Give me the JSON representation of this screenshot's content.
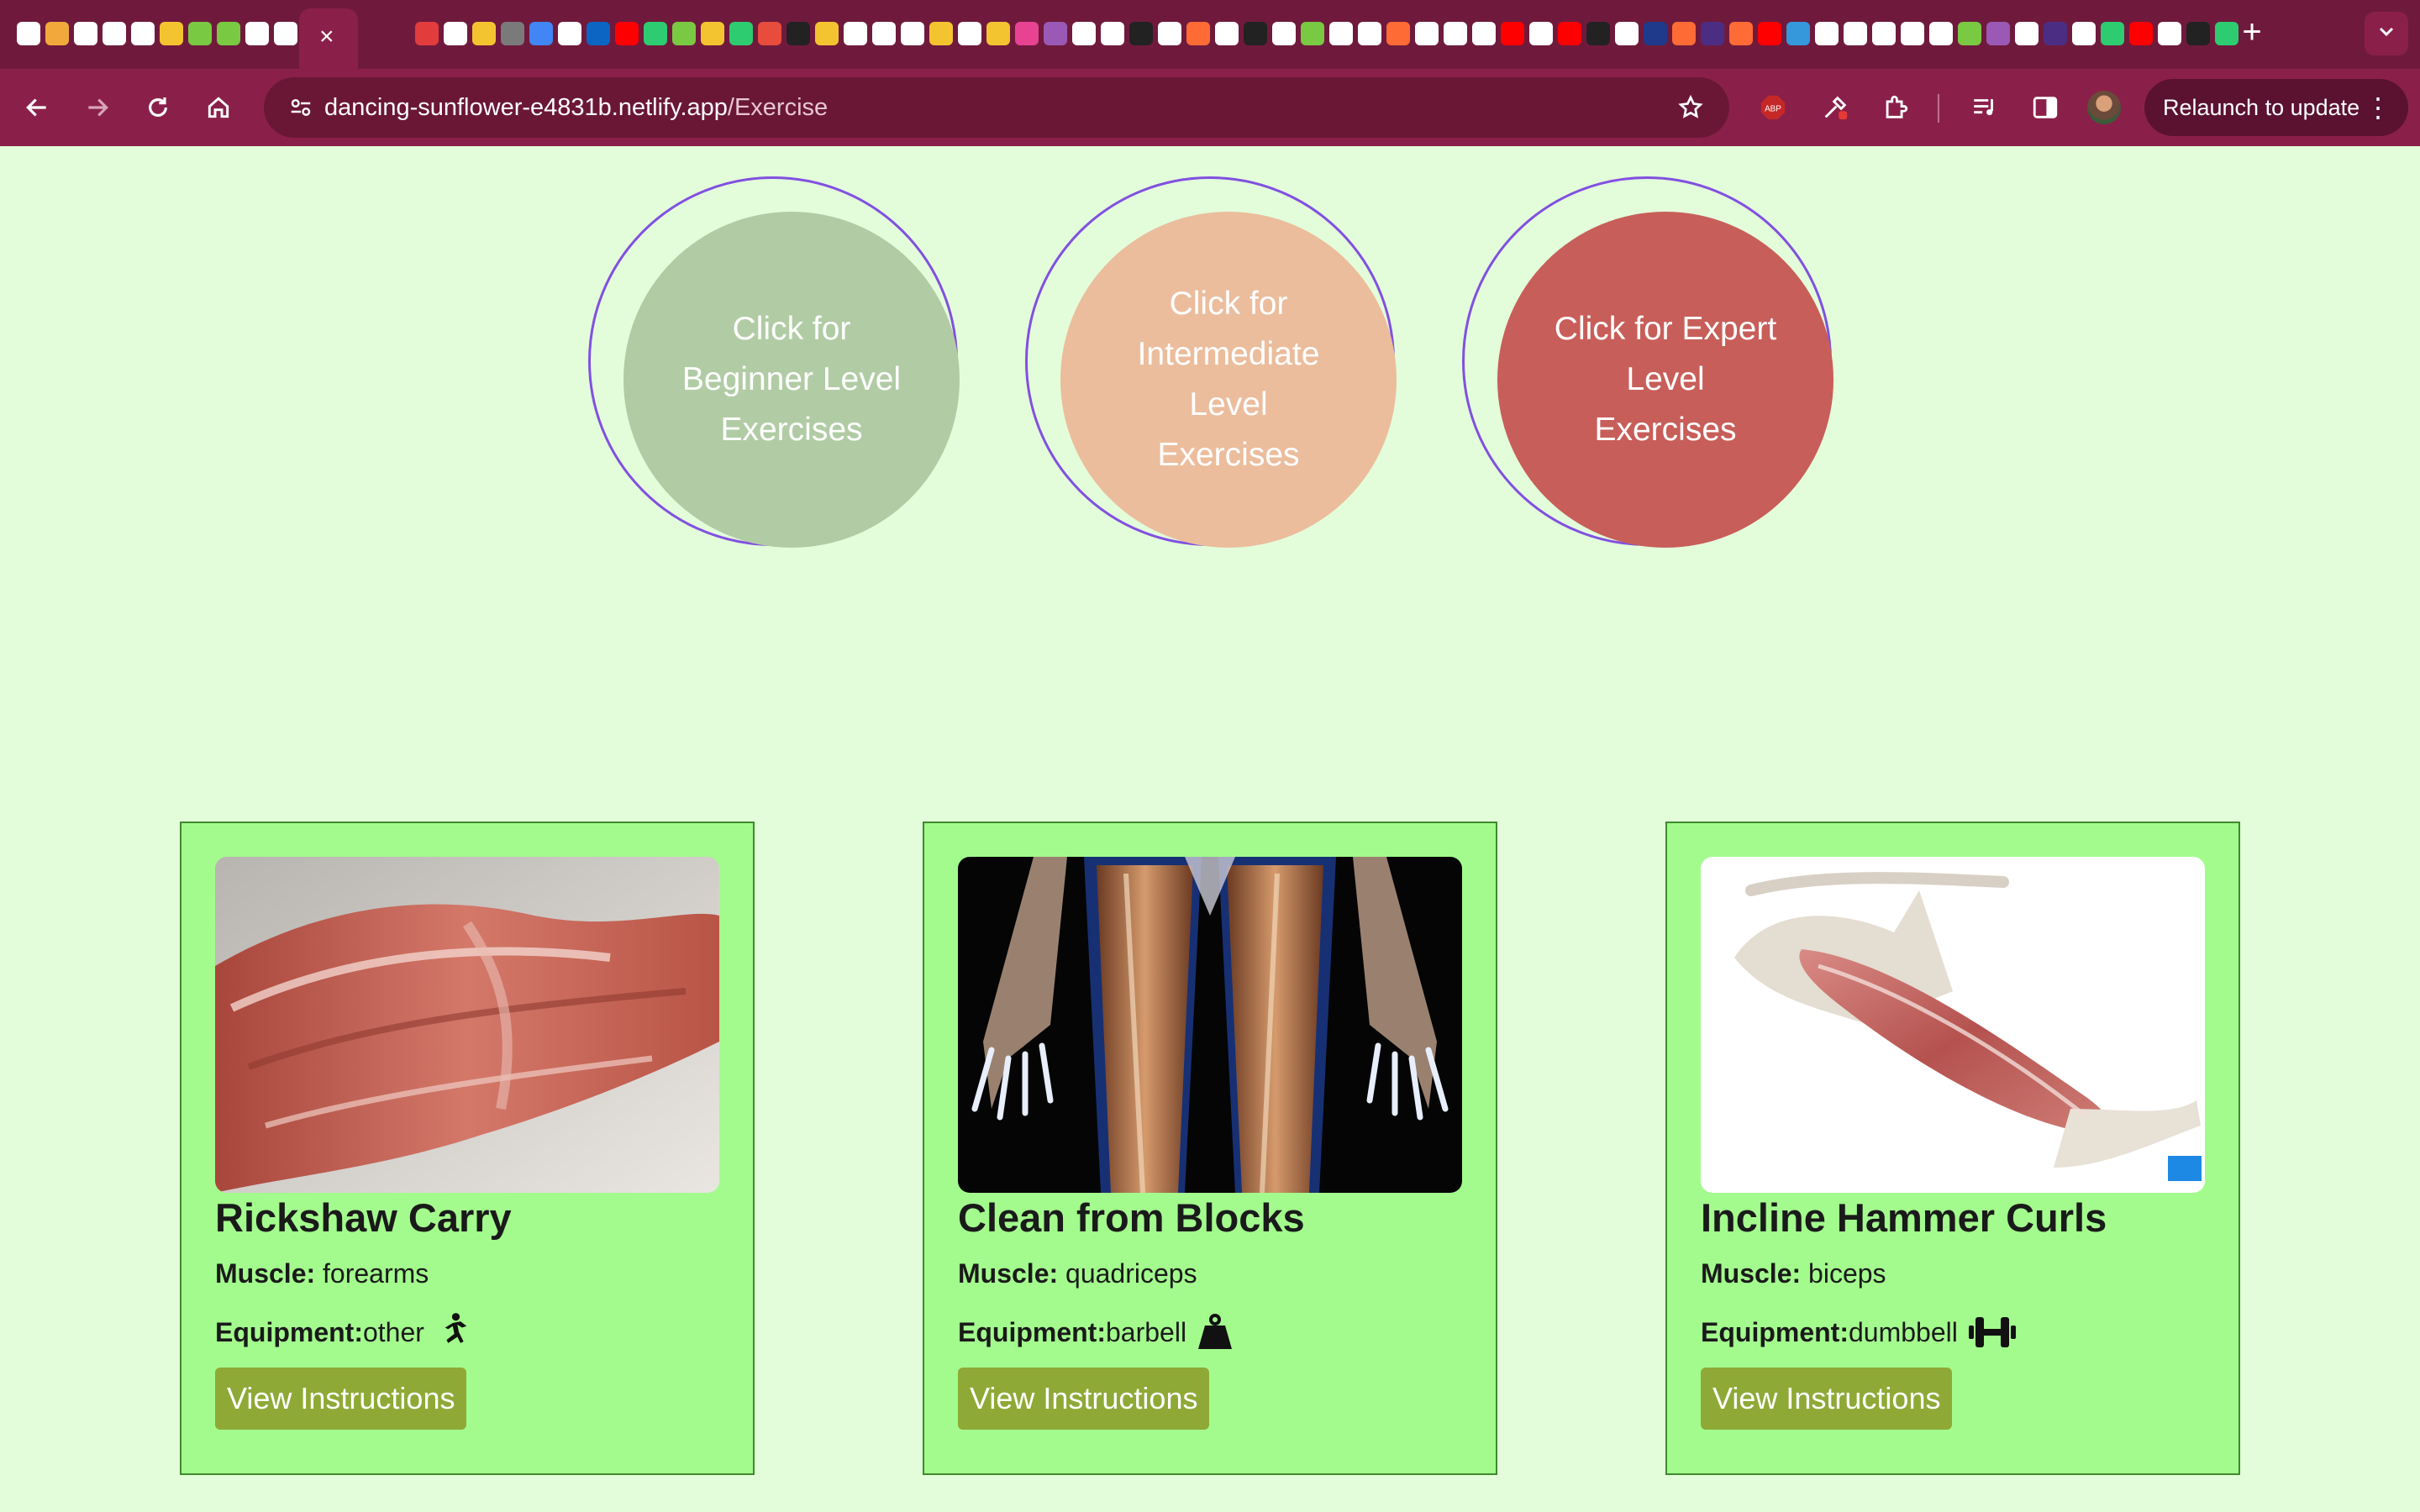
{
  "browser": {
    "tab_close_glyph": "×",
    "new_tab_glyph": "+",
    "url_host": "dancing-sunflower-e4831b.netlify.app",
    "url_path": "/Exercise",
    "relaunch_label": "Relaunch to update",
    "favicon_colors": [
      "#ffffff",
      "#f2a93b",
      "#ffffff",
      "#ffffff",
      "#ffffff",
      "#f4c430",
      "#7ac943",
      "#7ac943",
      "#ffffff",
      "#ffffff",
      "#ffffff",
      "#e23c3c",
      "#ffffff",
      "#f4c430",
      "#7a7a7a",
      "#4285f4",
      "#ffffff",
      "#0a66c2",
      "#ff0000",
      "#2ecc71",
      "#7ac943",
      "#f4c430",
      "#2ecc71",
      "#e74c3c",
      "#222222",
      "#f4c430",
      "#ffffff",
      "#ffffff",
      "#ffffff",
      "#f4c430",
      "#ffffff",
      "#f4c430",
      "#e84393",
      "#9b59b6",
      "#ffffff",
      "#ffffff",
      "#222222",
      "#ffffff",
      "#ff6b35",
      "#ffffff",
      "#222222",
      "#ffffff",
      "#7ac943",
      "#ffffff",
      "#ffffff",
      "#ff6b35",
      "#ffffff",
      "#ffffff",
      "#ffffff",
      "#ff0000",
      "#ffffff",
      "#ff0000",
      "#222222",
      "#ffffff",
      "#1f3a8a",
      "#ff6b35",
      "#4b2e83",
      "#ff6b35",
      "#ff0000",
      "#3498db",
      "#ffffff",
      "#ffffff",
      "#ffffff",
      "#ffffff",
      "#ffffff",
      "#7ac943",
      "#9b59b6",
      "#ffffff",
      "#4b2e83",
      "#ffffff",
      "#2ecc71",
      "#ff0000",
      "#ffffff",
      "#222222",
      "#2ecc71",
      "#2ecc71",
      "#ffffff",
      "#222222",
      "#ffffff",
      "#ffffff",
      "#222222",
      "#ff0000",
      "#ffffff",
      "#ff0000",
      "#ffffff",
      "#ff6b35",
      "#ff0000",
      "#3498db",
      "#3498db",
      "#ffffff"
    ]
  },
  "levels": [
    {
      "label": "Click for Beginner Level Exercises"
    },
    {
      "label": "Click for Intermediate Level Exercises"
    },
    {
      "label": "Click for Expert Level Exercises"
    }
  ],
  "exercises": [
    {
      "name": "Rickshaw Carry",
      "muscle_label": "Muscle:",
      "muscle": "forearms",
      "equipment_label": "Equipment:",
      "equipment": "other",
      "equipment_icon": "running-person-icon",
      "button": "View Instructions"
    },
    {
      "name": "Clean from Blocks",
      "muscle_label": "Muscle:",
      "muscle": "quadriceps",
      "equipment_label": "Equipment:",
      "equipment": "barbell",
      "equipment_icon": "weight-icon",
      "button": "View Instructions"
    },
    {
      "name": "Incline Hammer Curls",
      "muscle_label": "Muscle:",
      "muscle": "biceps",
      "equipment_label": "Equipment:",
      "equipment": "dumbbell",
      "equipment_icon": "dumbbell-icon",
      "button": "View Instructions"
    }
  ]
}
